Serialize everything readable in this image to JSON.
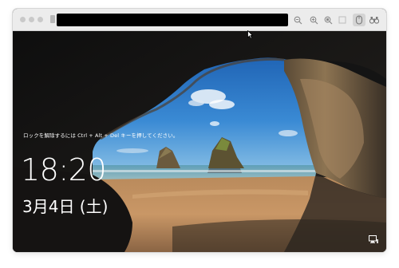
{
  "lockscreen": {
    "unlock_hint": "ロックを解除するには Ctrl + Alt + Del キーを押してください。",
    "time": "18:20",
    "date": "3月4日 (土)"
  },
  "icons": {
    "zoom_out": "zoom-out-icon",
    "zoom_in": "zoom-in-icon",
    "zoom_fit": "zoom-fit-icon",
    "mouse_capture": "mouse-icon",
    "binoculars": "binoculars-icon",
    "network": "network-icon"
  },
  "colors": {
    "titlebar": "#ececec",
    "sky": "#2f7fc9",
    "sand": "#c7905a",
    "cave": "#161616"
  }
}
